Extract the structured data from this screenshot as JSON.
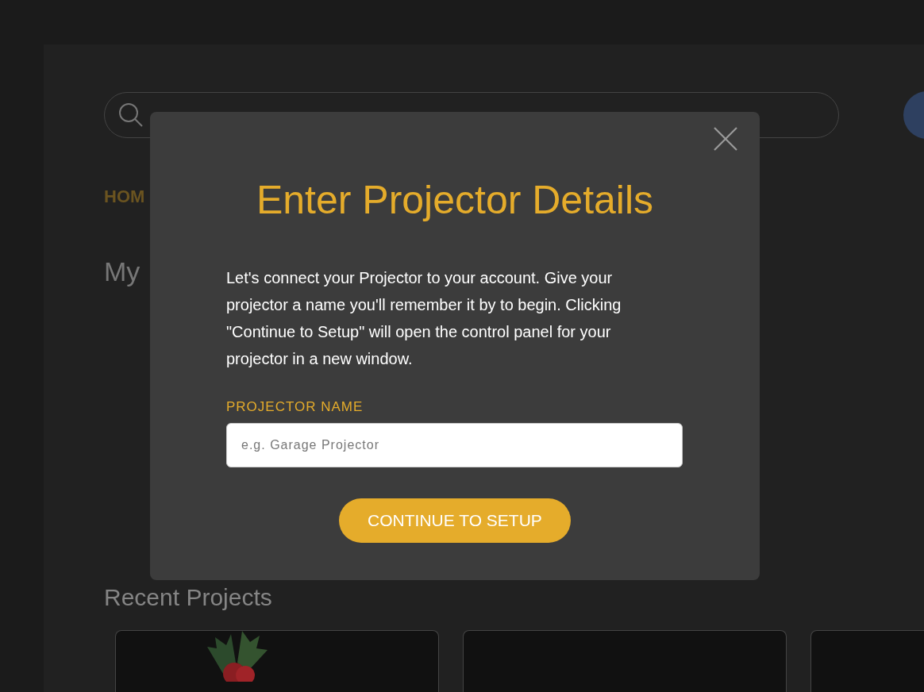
{
  "nav": {
    "home_label": "HOM"
  },
  "section_heading": "My",
  "recent": {
    "heading": "Recent Projects",
    "cards": [
      {
        "kind": "holly"
      },
      {
        "kind": "blank"
      },
      {
        "kind": "blank"
      }
    ]
  },
  "modal": {
    "title": "Enter Projector Details",
    "description": "Let's connect your Projector to your account. Give your projector a name you'll remember it by to begin. Clicking \"Continue to Setup\" will open the control panel for your projector in a new window.",
    "field_label": "PROJECTOR NAME",
    "field": {
      "placeholder": "e.g. Garage Projector"
    },
    "button": "CONTINUE TO SETUP"
  }
}
